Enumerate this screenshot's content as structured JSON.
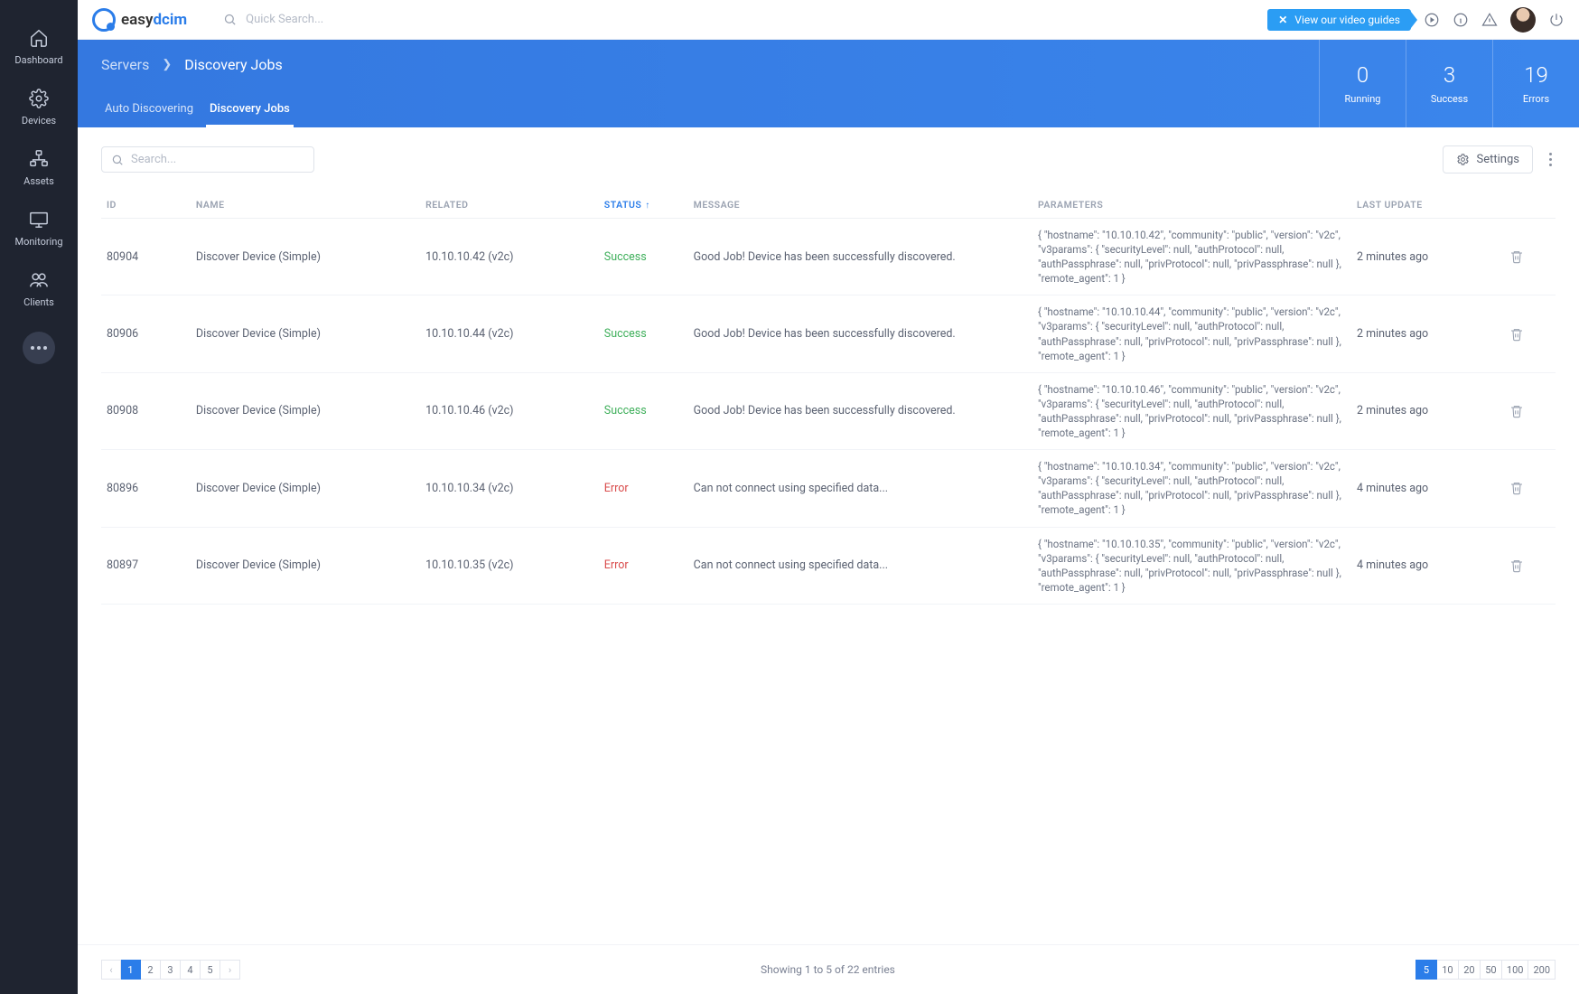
{
  "brand": {
    "name_a": "easy",
    "name_b": "dcim"
  },
  "topbar": {
    "search_placeholder": "Quick Search...",
    "video_guides": "View our video guides"
  },
  "sidebar": {
    "items": [
      {
        "label": "Dashboard"
      },
      {
        "label": "Devices"
      },
      {
        "label": "Assets"
      },
      {
        "label": "Monitoring"
      },
      {
        "label": "Clients"
      }
    ]
  },
  "header": {
    "breadcrumb_parent": "Servers",
    "breadcrumb_current": "Discovery Jobs",
    "tabs": [
      {
        "label": "Auto Discovering",
        "active": false
      },
      {
        "label": "Discovery Jobs",
        "active": true
      }
    ],
    "stats": [
      {
        "value": "0",
        "label": "Running"
      },
      {
        "value": "3",
        "label": "Success"
      },
      {
        "value": "19",
        "label": "Errors"
      }
    ]
  },
  "toolbar": {
    "search_placeholder": "Search...",
    "settings_label": "Settings"
  },
  "table": {
    "columns": {
      "id": "ID",
      "name": "NAME",
      "related": "RELATED",
      "status": "STATUS",
      "message": "MESSAGE",
      "parameters": "PARAMETERS",
      "last_update": "LAST UPDATE"
    },
    "status_colors": {
      "Success": "status-success",
      "Error": "status-error"
    },
    "rows": [
      {
        "id": "80904",
        "name": "Discover Device (Simple)",
        "related": "10.10.10.42 (v2c)",
        "status": "Success",
        "message": "Good Job! Device has been successfully discovered.",
        "parameters": "{ \"hostname\": \"10.10.10.42\", \"community\": \"public\", \"version\": \"v2c\", \"v3params\": { \"securityLevel\": null, \"authProtocol\": null, \"authPassphrase\": null, \"privProtocol\": null, \"privPassphrase\": null }, \"remote_agent\": 1 }",
        "last_update": "2 minutes ago"
      },
      {
        "id": "80906",
        "name": "Discover Device (Simple)",
        "related": "10.10.10.44 (v2c)",
        "status": "Success",
        "message": "Good Job! Device has been successfully discovered.",
        "parameters": "{ \"hostname\": \"10.10.10.44\", \"community\": \"public\", \"version\": \"v2c\", \"v3params\": { \"securityLevel\": null, \"authProtocol\": null, \"authPassphrase\": null, \"privProtocol\": null, \"privPassphrase\": null }, \"remote_agent\": 1 }",
        "last_update": "2 minutes ago"
      },
      {
        "id": "80908",
        "name": "Discover Device (Simple)",
        "related": "10.10.10.46 (v2c)",
        "status": "Success",
        "message": "Good Job! Device has been successfully discovered.",
        "parameters": "{ \"hostname\": \"10.10.10.46\", \"community\": \"public\", \"version\": \"v2c\", \"v3params\": { \"securityLevel\": null, \"authProtocol\": null, \"authPassphrase\": null, \"privProtocol\": null, \"privPassphrase\": null }, \"remote_agent\": 1 }",
        "last_update": "2 minutes ago"
      },
      {
        "id": "80896",
        "name": "Discover Device (Simple)",
        "related": "10.10.10.34 (v2c)",
        "status": "Error",
        "message": "Can not connect using specified data...",
        "parameters": "{ \"hostname\": \"10.10.10.34\", \"community\": \"public\", \"version\": \"v2c\", \"v3params\": { \"securityLevel\": null, \"authProtocol\": null, \"authPassphrase\": null, \"privProtocol\": null, \"privPassphrase\": null }, \"remote_agent\": 1 }",
        "last_update": "4 minutes ago"
      },
      {
        "id": "80897",
        "name": "Discover Device (Simple)",
        "related": "10.10.10.35 (v2c)",
        "status": "Error",
        "message": "Can not connect using specified data...",
        "parameters": "{ \"hostname\": \"10.10.10.35\", \"community\": \"public\", \"version\": \"v2c\", \"v3params\": { \"securityLevel\": null, \"authProtocol\": null, \"authPassphrase\": null, \"privProtocol\": null, \"privPassphrase\": null }, \"remote_agent\": 1 }",
        "last_update": "4 minutes ago"
      }
    ]
  },
  "footer": {
    "summary": "Showing 1 to 5 of 22 entries",
    "pages": [
      "1",
      "2",
      "3",
      "4",
      "5"
    ],
    "active_page": "1",
    "page_sizes": [
      "5",
      "10",
      "20",
      "50",
      "100",
      "200"
    ],
    "active_size": "5"
  }
}
